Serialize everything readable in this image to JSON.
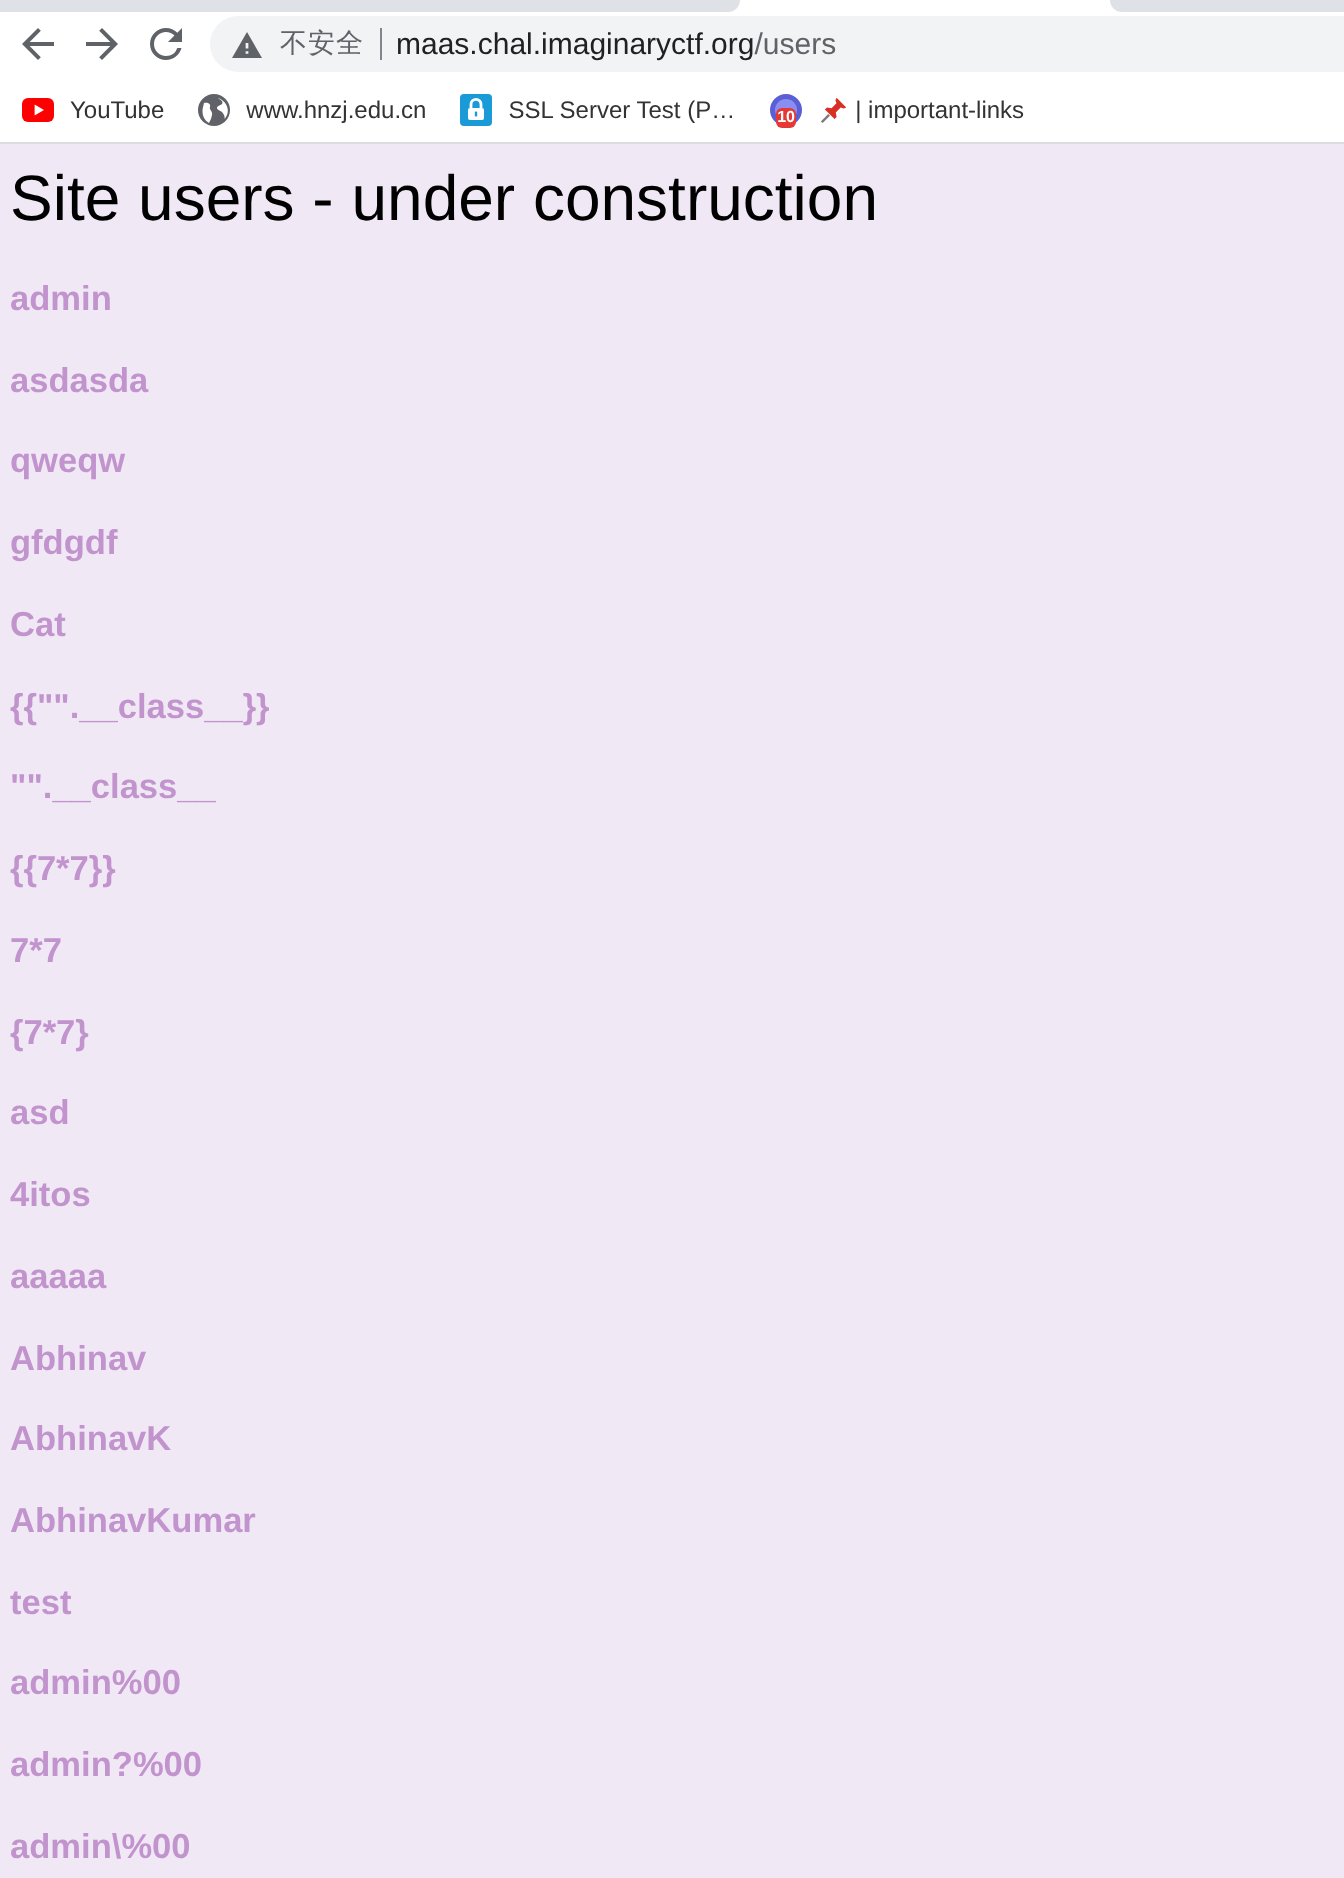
{
  "toolbar": {
    "security_label": "不安全",
    "url_host": "maas.chal.imaginaryctf.org",
    "url_path": "/users"
  },
  "bookmarks": [
    {
      "kind": "video",
      "label": "YouTube"
    },
    {
      "kind": "globe",
      "label": "www.hnzj.edu.cn"
    },
    {
      "kind": "lock",
      "label": "SSL Server Test (P…"
    },
    {
      "kind": "counter",
      "badge": "10",
      "pinned": true,
      "label": "| important-links"
    }
  ],
  "page": {
    "heading": "Site users - under construction",
    "users": [
      "admin",
      "asdasda",
      "qweqw",
      "gfdgdf",
      "Cat",
      "{{\"\".__class__}}",
      "\"\".__class__",
      "{{7*7}}",
      "7*7",
      "{7*7}",
      "asd",
      "4itos",
      "aaaaa",
      "Abhinav",
      "AbhinavK",
      "AbhinavKumar",
      "test",
      "admin%00",
      "admin?%00",
      "admin\\%00"
    ]
  }
}
